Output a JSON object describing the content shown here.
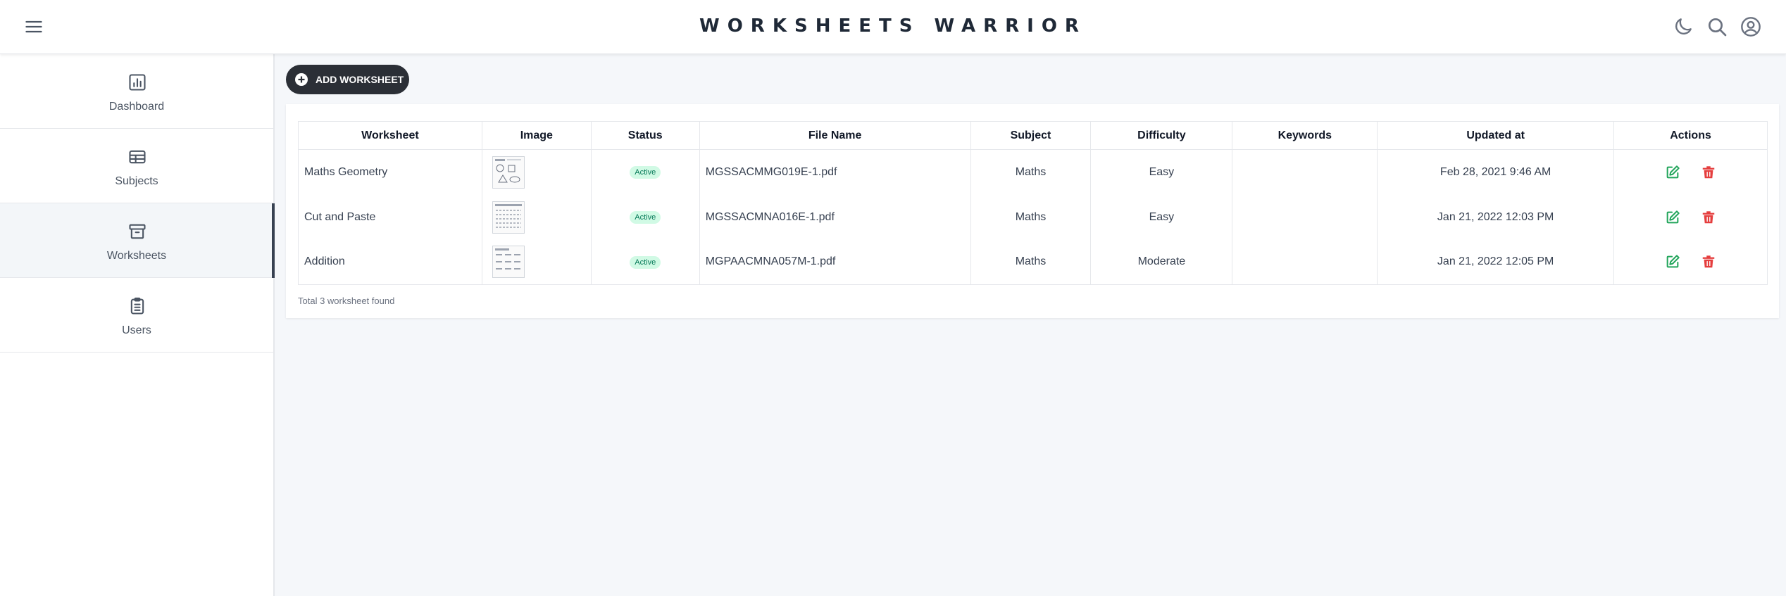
{
  "header": {
    "title": "WORKSHEETS WARRIOR",
    "icons": [
      "menu-icon",
      "moon-icon",
      "search-icon",
      "user-circle-icon"
    ]
  },
  "sidebar": {
    "items": [
      {
        "label": "Dashboard",
        "icon": "chart-icon",
        "active": false
      },
      {
        "label": "Subjects",
        "icon": "table-icon",
        "active": false
      },
      {
        "label": "Worksheets",
        "icon": "archive-icon",
        "active": true
      },
      {
        "label": "Users",
        "icon": "clipboard-icon",
        "active": false
      }
    ]
  },
  "main": {
    "add_button_label": "ADD WORKSHEET",
    "table": {
      "headers": [
        "Worksheet",
        "Image",
        "Status",
        "File Name",
        "Subject",
        "Difficulty",
        "Keywords",
        "Updated at",
        "Actions"
      ],
      "rows": [
        {
          "worksheet": "Maths Geometry",
          "status": "Active",
          "file_name": "MGSSACMMG019E-1.pdf",
          "subject": "Maths",
          "difficulty": "Easy",
          "keywords": "",
          "updated_at": "Feb 28, 2021 9:46 AM"
        },
        {
          "worksheet": "Cut and Paste",
          "status": "Active",
          "file_name": "MGSSACMNA016E-1.pdf",
          "subject": "Maths",
          "difficulty": "Easy",
          "keywords": "",
          "updated_at": "Jan 21, 2022 12:03 PM"
        },
        {
          "worksheet": "Addition",
          "status": "Active",
          "file_name": "MGPAACMNA057M-1.pdf",
          "subject": "Maths",
          "difficulty": "Moderate",
          "keywords": "",
          "updated_at": "Jan 21, 2022 12:05 PM"
        }
      ]
    },
    "total_text": "Total 3 worksheet found"
  },
  "colors": {
    "active_badge_bg": "#d1fae5",
    "active_badge_text": "#047857",
    "edit_icon": "#22a55b",
    "delete_icon": "#e53e3e",
    "button_bg": "#2b2f36"
  }
}
